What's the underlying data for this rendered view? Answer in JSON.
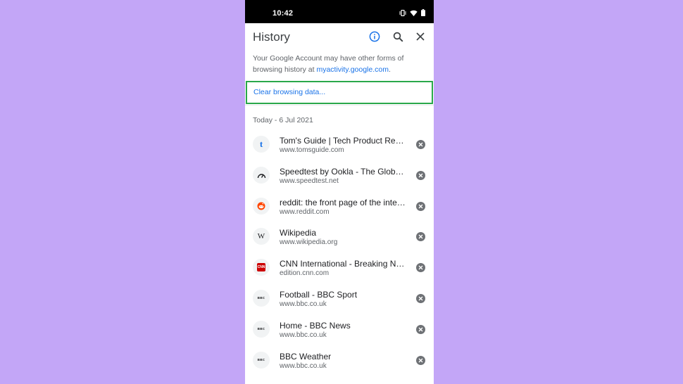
{
  "status_bar": {
    "time": "10:42",
    "icons": [
      "vibrate-icon",
      "wifi-icon",
      "battery-icon"
    ]
  },
  "app_bar": {
    "title": "History",
    "actions": [
      "info-icon",
      "search-icon",
      "close-icon"
    ]
  },
  "account_note": {
    "text_before": "Your Google Account may have other forms of browsing history at ",
    "link": "myactivity.google.com",
    "text_after": "."
  },
  "clear_data_label": "Clear browsing data...",
  "date_header": "Today - 6 Jul 2021",
  "entries": [
    {
      "title": "Tom's Guide | Tech Product Reviews, Top Picks and How To",
      "url": "www.tomsguide.com",
      "favicon": "t",
      "favicon_color": "#1a73e8"
    },
    {
      "title": "Speedtest by Ookla - The Global Broadband Speed Test",
      "url": "www.speedtest.net",
      "favicon": "speedometer",
      "favicon_color": "#202124"
    },
    {
      "title": "reddit: the front page of the internet",
      "url": "www.reddit.com",
      "favicon": "reddit",
      "favicon_color": "#ff4500"
    },
    {
      "title": "Wikipedia",
      "url": "www.wikipedia.org",
      "favicon": "W",
      "favicon_color": "#202124"
    },
    {
      "title": "CNN International - Breaking News, US News, World News",
      "url": "edition.cnn.com",
      "favicon": "CNN",
      "favicon_color": "#cc0000"
    },
    {
      "title": "Football - BBC Sport",
      "url": "www.bbc.co.uk",
      "favicon": "BBC",
      "favicon_color": "#202124"
    },
    {
      "title": "Home - BBC News",
      "url": "www.bbc.co.uk",
      "favicon": "BBC",
      "favicon_color": "#202124"
    },
    {
      "title": "BBC Weather",
      "url": "www.bbc.co.uk",
      "favicon": "BBC",
      "favicon_color": "#202124"
    }
  ],
  "colors": {
    "background": "#c3a6f7",
    "accent": "#1a73e8",
    "highlight_border": "#2aa84a"
  }
}
